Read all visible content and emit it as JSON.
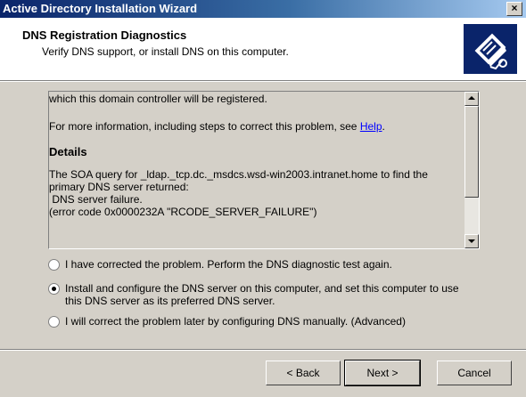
{
  "window": {
    "title": "Active Directory Installation Wizard",
    "close_glyph": "×"
  },
  "header": {
    "title": "DNS Registration Diagnostics",
    "subtitle": "Verify DNS support, or install DNS on this computer.",
    "icon": "directory-book-icon"
  },
  "content": {
    "line1": "which this domain controller will be registered.",
    "more_info_prefix": "For more information, including steps to correct this problem, see ",
    "help_link": "Help",
    "more_info_suffix": ".",
    "details_heading": "Details",
    "details_line1": "The SOA query for _ldap._tcp.dc._msdcs.wsd-win2003.intranet.home to find the",
    "details_line2": "primary DNS server returned:",
    "details_line3": " DNS server failure.",
    "details_line4": "(error code 0x0000232A \"RCODE_SERVER_FAILURE\")"
  },
  "options": [
    {
      "label": "I have corrected the problem. Perform the DNS diagnostic test again.",
      "selected": false
    },
    {
      "label_line1": "Install and configure the DNS server on this computer, and set this computer to use",
      "label_line2": "this DNS server as its preferred DNS server.",
      "selected": true
    },
    {
      "label": "I will correct the problem later by configuring DNS manually. (Advanced)",
      "selected": false
    }
  ],
  "buttons": {
    "back": "< Back",
    "next": "Next >",
    "cancel": "Cancel"
  }
}
